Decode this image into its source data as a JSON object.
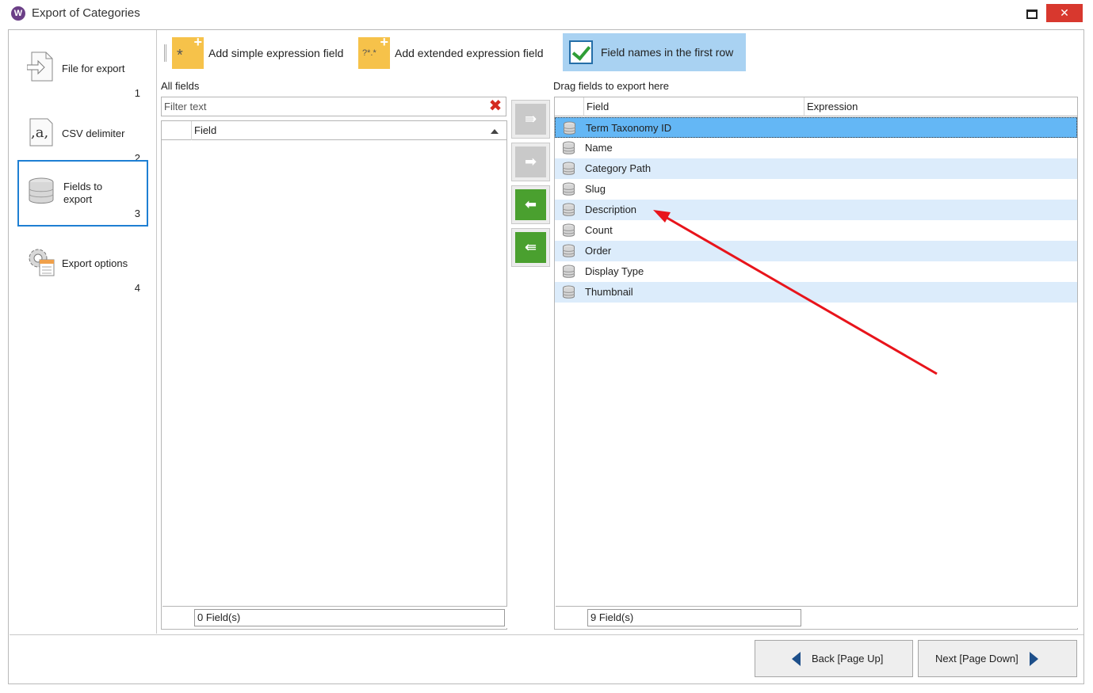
{
  "window": {
    "title": "Export of Categories",
    "app_icon_glyph": "W",
    "close_glyph": "✕"
  },
  "nav": {
    "items": [
      {
        "label": "File for export",
        "number": "1",
        "icon": "file-export-icon"
      },
      {
        "label": "CSV delimiter",
        "number": "2",
        "icon": "csv-delimiter-icon"
      },
      {
        "label": "Fields to export",
        "number": "3",
        "icon": "database-icon",
        "selected": true
      },
      {
        "label": "Export options",
        "number": "4",
        "icon": "settings-gear-icon"
      }
    ]
  },
  "toolbar": {
    "add_simple_label": "Add simple expression field",
    "add_extended_label": "Add extended expression field",
    "field_names_label": "Field names in the first row",
    "field_names_checked": true,
    "simple_icon_glyph": "*",
    "extended_icon_glyph": "?*.*",
    "plus_glyph": "+"
  },
  "left_pane": {
    "title": "All fields",
    "filter_placeholder": "Filter text",
    "clear_glyph": "✖",
    "columns": [
      "Field"
    ],
    "rows": [],
    "footer": "0 Field(s)"
  },
  "move_buttons": [
    {
      "name": "move-all-right-button",
      "glyph": "⇛",
      "enabled": false
    },
    {
      "name": "move-right-button",
      "glyph": "➡",
      "enabled": false
    },
    {
      "name": "move-left-button",
      "glyph": "⬅",
      "enabled": true
    },
    {
      "name": "move-all-left-button",
      "glyph": "⇚",
      "enabled": true
    }
  ],
  "right_pane": {
    "title": "Drag fields to export here",
    "columns": [
      "Field",
      "Expression"
    ],
    "rows": [
      {
        "field": "Term Taxonomy ID",
        "expression": "",
        "selected": true
      },
      {
        "field": "Name",
        "expression": ""
      },
      {
        "field": "Category Path",
        "expression": ""
      },
      {
        "field": "Slug",
        "expression": ""
      },
      {
        "field": "Description",
        "expression": ""
      },
      {
        "field": "Count",
        "expression": ""
      },
      {
        "field": "Order",
        "expression": ""
      },
      {
        "field": "Display Type",
        "expression": ""
      },
      {
        "field": "Thumbnail",
        "expression": ""
      }
    ],
    "footer": "9 Field(s)"
  },
  "buttons": {
    "back_label": "Back [Page Up]",
    "next_label": "Next [Page Down]"
  },
  "colors": {
    "selected_row": "#64b7f5",
    "alt_row": "#dcecfb",
    "nav_selected_border": "#1e7fd3",
    "close_button": "#d8382e",
    "annotation_arrow": "#e8141b"
  }
}
